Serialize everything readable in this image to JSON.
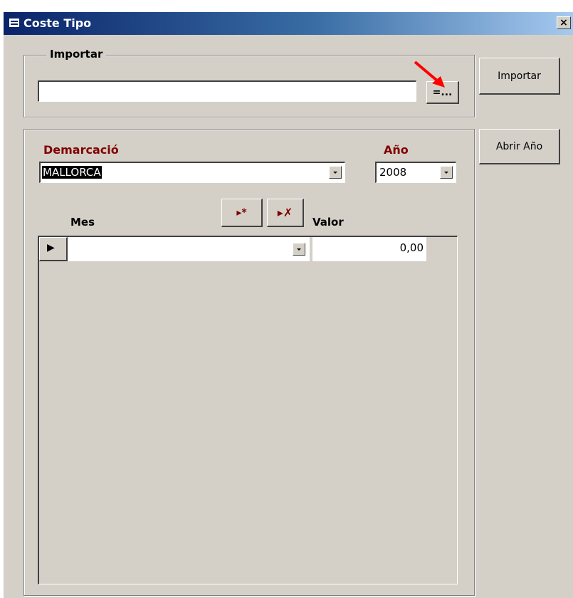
{
  "window": {
    "title": "Coste Tipo",
    "close_glyph": "×"
  },
  "import_group": {
    "legend": "Importar",
    "path_value": "",
    "browse_label": "=..."
  },
  "buttons": {
    "import_label": "Importar",
    "open_year_label": "Abrir Año"
  },
  "form": {
    "demarcacion_label": "Demarcació",
    "demarcacion_value": "MALLORCA",
    "anio_label": "Año",
    "anio_value": "2008"
  },
  "subform": {
    "new_record_icon": "▸*",
    "delete_record_icon": "▸✗",
    "columns": {
      "mes": "Mes",
      "valor": "Valor"
    },
    "rows": [
      {
        "selector_glyph": "▶",
        "mes": "",
        "valor": "0,00"
      }
    ]
  },
  "annotation": {
    "color": "#ff0000"
  }
}
